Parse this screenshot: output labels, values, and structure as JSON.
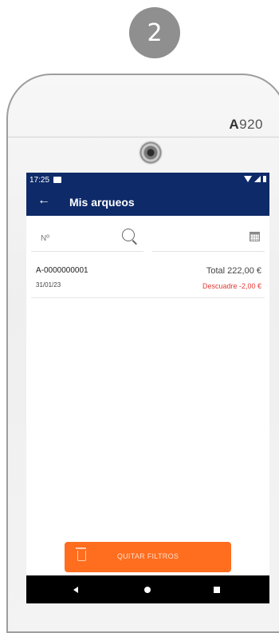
{
  "step": {
    "number": "2"
  },
  "device": {
    "model_prefix": "A",
    "model_number": "920"
  },
  "statusbar": {
    "time": "17:25"
  },
  "appbar": {
    "title": "Mis arqueos"
  },
  "filters": {
    "number_placeholder": "Nº"
  },
  "list": {
    "items": [
      {
        "code": "A-0000000001",
        "date": "31/01/23",
        "total": "Total 222,00 €",
        "descuadre": "Descuadre -2,00 €"
      }
    ]
  },
  "actions": {
    "quitar_filtros": "QUITAR FILTROS"
  },
  "colors": {
    "appbar": "#0e2a69",
    "accent": "#ff6d1f",
    "negative": "#e53935"
  }
}
